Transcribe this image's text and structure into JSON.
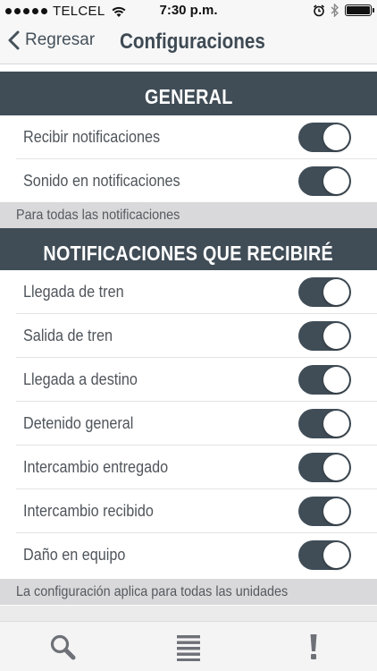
{
  "status_bar": {
    "carrier": "TELCEL",
    "time": "7:30 p.m."
  },
  "navbar": {
    "back_label": "Regresar",
    "title": "Configuraciones"
  },
  "sections": [
    {
      "header": "GENERAL",
      "rows": [
        {
          "label": "Recibir notificaciones",
          "on": true
        },
        {
          "label": "Sonido en notificaciones",
          "on": true
        }
      ],
      "footer": "Para todas las notificaciones"
    },
    {
      "header": "NOTIFICACIONES QUE RECIBIRÉ",
      "rows": [
        {
          "label": "Llegada de tren",
          "on": true
        },
        {
          "label": "Salida de tren",
          "on": true
        },
        {
          "label": "Llegada a destino",
          "on": true
        },
        {
          "label": "Detenido general",
          "on": true
        },
        {
          "label": "Intercambio entregado",
          "on": true
        },
        {
          "label": "Intercambio recibido",
          "on": true
        },
        {
          "label": "Daño en equipo",
          "on": true
        }
      ],
      "footer": "La configuración aplica para todas las unidades"
    }
  ],
  "tabbar": {
    "items": [
      {
        "icon": "search-icon"
      },
      {
        "icon": "list-icon"
      },
      {
        "icon": "alert-icon"
      }
    ]
  },
  "colors": {
    "accent": "#404d57",
    "footer_bg": "#d9d9db"
  }
}
